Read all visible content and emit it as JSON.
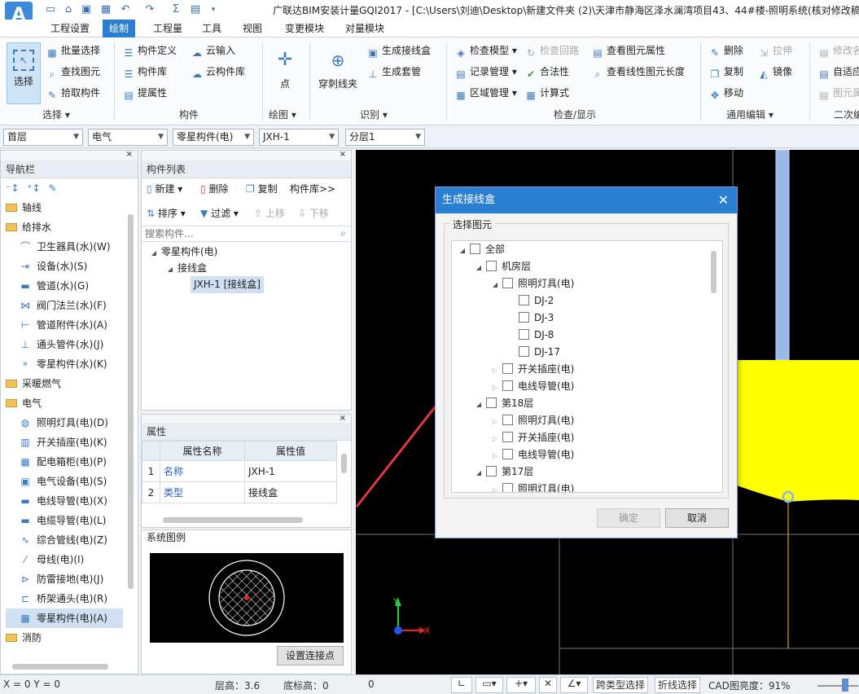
{
  "app": {
    "logo": "A",
    "title": "广联达BIM安装计量GQI2017 - [C:\\Users\\刘迪\\Desktop\\新建文件夹 (2)\\天津市静海区泽水澜湾项目43、44#楼-照明系统(核对修改稿"
  },
  "menu": [
    "工程设置",
    "绘制",
    "工程量",
    "工具",
    "视图",
    "变更模块",
    "对量模块"
  ],
  "ribbon": {
    "select": {
      "big": "选择",
      "items": [
        "批量选择",
        "查找图元",
        "拾取构件"
      ],
      "group": "选择"
    },
    "component": {
      "items": [
        "构件定义",
        "构件库",
        "提属性",
        "云输入",
        "云构件库"
      ],
      "group": "构件"
    },
    "draw": {
      "big": "点",
      "group": "绘图"
    },
    "identify": {
      "big": "穿刺线夹",
      "items": [
        "生成接线盒",
        "生成套管"
      ],
      "group": "识别"
    },
    "check": {
      "items": [
        "检查模型",
        "记录管理",
        "区域管理",
        "检查回路",
        "合法性",
        "计算式",
        "查看图元属性",
        "查看线性图元长度"
      ],
      "group": "检查/显示"
    },
    "edit": {
      "items": [
        "删除",
        "复制",
        "移动",
        "拉伸",
        "镜像"
      ],
      "group": "通用编辑"
    },
    "second": {
      "items": [
        "修改名",
        "自适应",
        "图元属"
      ],
      "group": "二次编"
    }
  },
  "selects": [
    "首层",
    "电气",
    "零星构件(电)",
    "JXH-1",
    "分层1"
  ],
  "nav": {
    "title": "导航栏",
    "items": [
      {
        "label": "轴线",
        "type": "folder"
      },
      {
        "label": "给排水",
        "type": "folder"
      },
      {
        "label": "卫生器具(水)(W)",
        "type": "item",
        "icon": "toilet-icon"
      },
      {
        "label": "设备(水)(S)",
        "type": "item",
        "icon": "equipment-icon"
      },
      {
        "label": "管道(水)(G)",
        "type": "item",
        "icon": "pipe-icon"
      },
      {
        "label": "阀门法兰(水)(F)",
        "type": "item",
        "icon": "valve-icon"
      },
      {
        "label": "管道附件(水)(A)",
        "type": "item",
        "icon": "pipe-fitting-icon"
      },
      {
        "label": "通头管件(水)(J)",
        "type": "item",
        "icon": "tee-icon"
      },
      {
        "label": "零星构件(水)(K)",
        "type": "item",
        "icon": "misc-icon"
      },
      {
        "label": "采暖燃气",
        "type": "folder"
      },
      {
        "label": "电气",
        "type": "folder"
      },
      {
        "label": "照明灯具(电)(D)",
        "type": "item",
        "icon": "bulb-icon"
      },
      {
        "label": "开关插座(电)(K)",
        "type": "item",
        "icon": "switch-icon"
      },
      {
        "label": "配电箱柜(电)(P)",
        "type": "item",
        "icon": "panel-icon"
      },
      {
        "label": "电气设备(电)(S)",
        "type": "item",
        "icon": "device-icon"
      },
      {
        "label": "电线导管(电)(X)",
        "type": "item",
        "icon": "conduit-icon"
      },
      {
        "label": "电缆导管(电)(L)",
        "type": "item",
        "icon": "cable-icon"
      },
      {
        "label": "综合管线(电)(Z)",
        "type": "item",
        "icon": "pipeline-icon"
      },
      {
        "label": "母线(电)(I)",
        "type": "item",
        "icon": "busbar-icon"
      },
      {
        "label": "防雷接地(电)(J)",
        "type": "item",
        "icon": "ground-icon"
      },
      {
        "label": "桥架通头(电)(R)",
        "type": "item",
        "icon": "tray-icon"
      },
      {
        "label": "零星构件(电)(A)",
        "type": "item",
        "icon": "grid-icon",
        "selected": true
      },
      {
        "label": "消防",
        "type": "folder"
      }
    ]
  },
  "complist": {
    "title": "构件列表",
    "toolbar": [
      "新建",
      "删除",
      "复制",
      "构件库>>",
      "排序",
      "过滤",
      "上移",
      "下移"
    ],
    "search_placeholder": "搜索构件...",
    "tree": [
      "零星构件(电)",
      "接线盒",
      "JXH-1 [接线盒]"
    ]
  },
  "props": {
    "title": "属性",
    "headers": [
      "属性名称",
      "属性值"
    ],
    "rows": [
      {
        "n": "1",
        "name": "名称",
        "value": "JXH-1"
      },
      {
        "n": "2",
        "name": "类型",
        "value": "接线盒"
      }
    ]
  },
  "legend": {
    "title": "系统图例",
    "button": "设置连接点"
  },
  "dialog": {
    "title": "生成接线盒",
    "group": "选择图元",
    "tree": [
      {
        "label": "全部",
        "level": 0,
        "arrow": "open"
      },
      {
        "label": "机房层",
        "level": 1,
        "arrow": "open"
      },
      {
        "label": "照明灯具(电)",
        "level": 2,
        "arrow": "open"
      },
      {
        "label": "DJ-2",
        "level": 3,
        "arrow": "none"
      },
      {
        "label": "DJ-3",
        "level": 3,
        "arrow": "none"
      },
      {
        "label": "DJ-8",
        "level": 3,
        "arrow": "none"
      },
      {
        "label": "DJ-17",
        "level": 3,
        "arrow": "none"
      },
      {
        "label": "开关插座(电)",
        "level": 2,
        "arrow": "closed"
      },
      {
        "label": "电线导管(电)",
        "level": 2,
        "arrow": "closed"
      },
      {
        "label": "第18层",
        "level": 1,
        "arrow": "open"
      },
      {
        "label": "照明灯具(电)",
        "level": 2,
        "arrow": "closed"
      },
      {
        "label": "开关插座(电)",
        "level": 2,
        "arrow": "closed"
      },
      {
        "label": "电线导管(电)",
        "level": 2,
        "arrow": "closed"
      },
      {
        "label": "第17层",
        "level": 1,
        "arrow": "open"
      },
      {
        "label": "照明灯具(电)",
        "level": 2,
        "arrow": "closed"
      }
    ],
    "ok": "确定",
    "cancel": "取消"
  },
  "axes": {
    "x": "X",
    "y": "Y"
  },
  "status": {
    "coords": "X = 0 Y = 0",
    "floor_height": "层高：3.6",
    "bottom_elev": "底标高：0",
    "zero": "0",
    "cross_select": "跨类型选择",
    "polyline_select": "折线选择",
    "cad_brightness": "CAD图亮度：91%"
  }
}
